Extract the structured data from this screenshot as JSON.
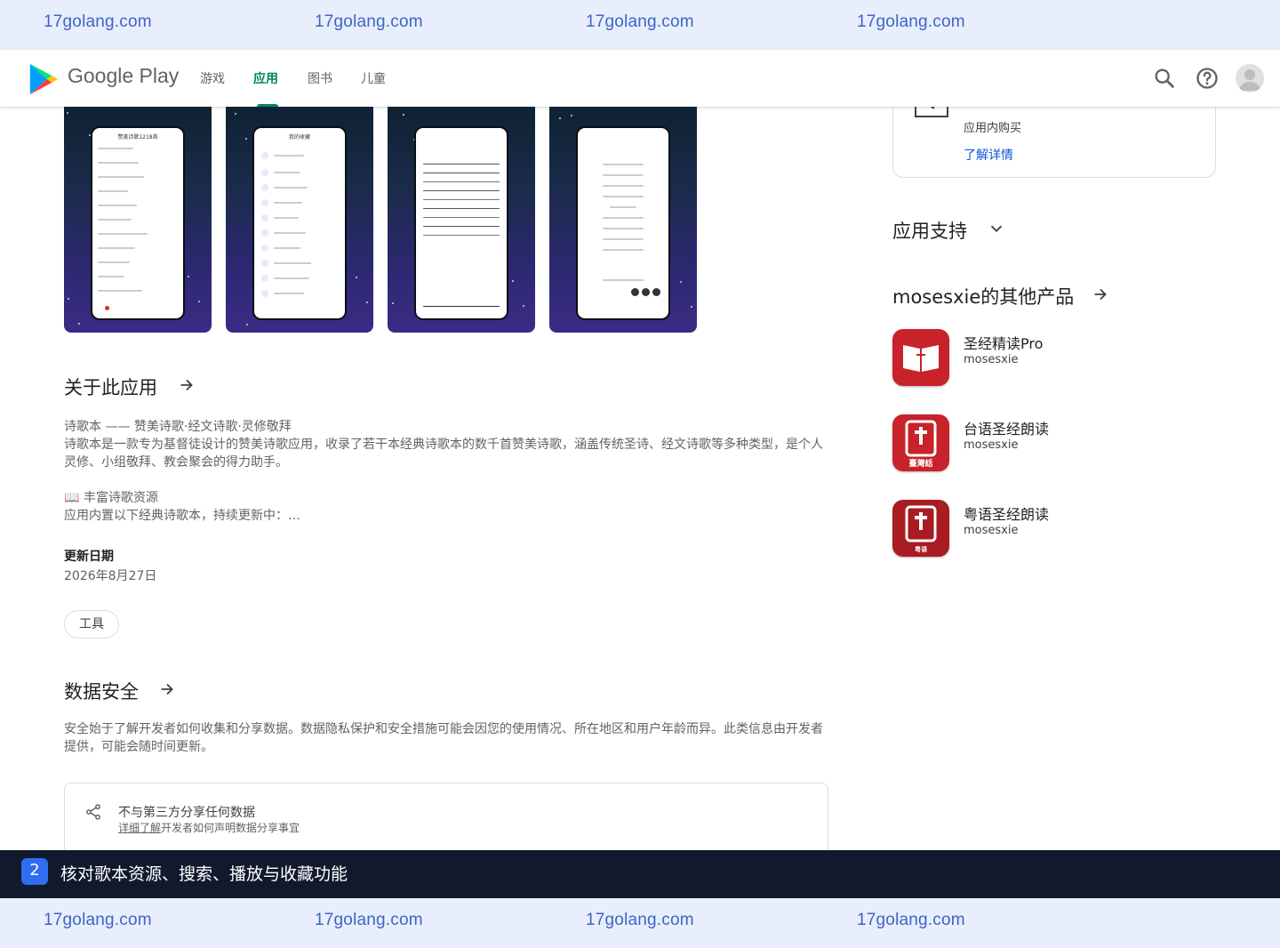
{
  "watermark": [
    "17golang.com",
    "17golang.com",
    "17golang.com",
    "17golang.com"
  ],
  "header": {
    "brand": "Google Play",
    "nav": [
      "游戏",
      "应用",
      "图书",
      "儿童"
    ],
    "active_nav": "应用"
  },
  "screenshots": {
    "shot1_title": "赞美诗歌1218首",
    "shot2_title": "我的收藏"
  },
  "about": {
    "title": "关于此应用",
    "line1": "诗歌本 —— 赞美诗歌·经文诗歌·灵修敬拜",
    "line2": "诗歌本是一款专为基督徒设计的赞美诗歌应用，收录了若干本经典诗歌本的数千首赞美诗歌，涵盖传统圣诗、经文诗歌等多种类型，是个人灵修、小组敬拜、教会聚会的得力助手。",
    "line3": "📖 丰富诗歌资源",
    "line4": "应用内置以下经典诗歌本，持续更新中：…",
    "updated_label": "更新日期",
    "updated_value": "2026年8月27日",
    "chip": "工具"
  },
  "data_safety": {
    "title": "数据安全",
    "desc": "安全始于了解开发者如何收集和分享数据。数据隐私保护和安全措施可能会因您的使用情况、所在地区和用户年龄而异。此类信息由开发者提供，可能会随时间更新。",
    "item_title": "不与第三方分享任何数据",
    "item_link": "详细了解",
    "item_rest": "开发者如何声明数据分享事宜"
  },
  "side": {
    "iap": "应用内购买",
    "learn_more": "了解详情",
    "support_title": "应用支持",
    "more_title": "mosesxie的其他产品",
    "products": [
      {
        "name": "圣经精读Pro",
        "dev": "mosesxie",
        "badge": ""
      },
      {
        "name": "台语圣经朗读",
        "dev": "mosesxie",
        "badge": "臺灣話"
      },
      {
        "name": "粤语圣经朗读",
        "dev": "mosesxie",
        "badge": "粤语"
      }
    ]
  },
  "banner": {
    "number": "2",
    "text": "核对歌本资源、搜索、播放与收藏功能"
  },
  "colors": {
    "accent": "#01875f",
    "link": "#0b57d0",
    "banner_bg": "#111a2d",
    "watermark_bg": "#e8eefb",
    "product_icon": "#c8222b"
  }
}
